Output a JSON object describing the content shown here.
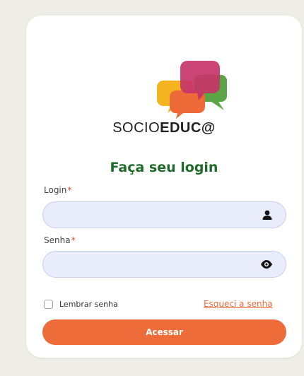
{
  "brand": {
    "part1": "SOCIO",
    "part2": "EDUC@"
  },
  "title": "Faça seu login",
  "login": {
    "label": "Login",
    "required_mark": "*",
    "value": "",
    "placeholder": ""
  },
  "password": {
    "label": "Senha",
    "required_mark": "*",
    "value": "",
    "placeholder": ""
  },
  "remember_label": "Lembrar senha",
  "forgot_link": "Esqueci a senha",
  "submit_label": "Acessar",
  "colors": {
    "background": "#efeee6",
    "card": "#ffffff",
    "title_green": "#1f6b2a",
    "accent_orange": "#ee6b3a",
    "input_bg": "#e8ecfb",
    "input_border": "#c8cdf1",
    "required_red": "#e04a2a"
  },
  "icons": {
    "logo": "speech-bubbles-logo-icon",
    "login": "user-icon",
    "password": "eye-icon"
  }
}
